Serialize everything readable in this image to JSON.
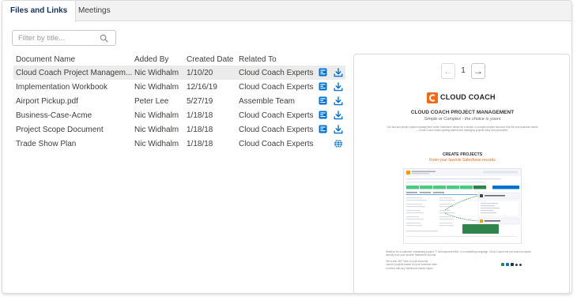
{
  "tabs": [
    {
      "label": "Files and Links",
      "active": true
    },
    {
      "label": "Meetings",
      "active": false
    }
  ],
  "filter": {
    "placeholder": "Filter by title...",
    "value": ""
  },
  "table": {
    "columns": [
      "Document Name",
      "Added By",
      "Created Date",
      "Related To"
    ],
    "rows": [
      {
        "name": "Cloud Coach Project Managem...",
        "added_by": "Nic Widhalm",
        "created": "1/10/20",
        "related": "Cloud Coach Experts",
        "icons": [
          "slides-icon",
          "download-icon"
        ],
        "selected": true
      },
      {
        "name": "Implementation Workbook",
        "added_by": "Nic Widhalm",
        "created": "12/16/19",
        "related": "Cloud Coach Experts",
        "icons": [
          "slides-icon",
          "download-icon"
        ],
        "selected": false
      },
      {
        "name": "Airport Pickup.pdf",
        "added_by": "Peter Lee",
        "created": "5/27/19",
        "related": "Assemble Team",
        "icons": [
          "slides-icon",
          "download-icon"
        ],
        "selected": false
      },
      {
        "name": "Business-Case-Acme",
        "added_by": "Nic Widhalm",
        "created": "1/18/18",
        "related": "Cloud Coach Experts",
        "icons": [
          "slides-icon",
          "download-icon"
        ],
        "selected": false
      },
      {
        "name": "Project Scope Document",
        "added_by": "Nic Widhalm",
        "created": "1/18/18",
        "related": "Cloud Coach Experts",
        "icons": [
          "slides-icon",
          "download-icon"
        ],
        "selected": false
      },
      {
        "name": "Trade Show Plan",
        "added_by": "Nic Widhalm",
        "created": "1/18/18",
        "related": "Cloud Coach Experts",
        "icons": [
          "",
          "globe-link-icon"
        ],
        "selected": false
      }
    ]
  },
  "preview": {
    "page": "1",
    "prev_symbol": "←",
    "next_symbol": "→",
    "document": {
      "logo_text": "CLOUD COACH",
      "title": "CLOUD COACH PROJECT MANAGEMENT",
      "subtitle": "Simple or Complex - the choice is yours",
      "paragraph": "Our fast and simple project management within Salesforce allows for a simple or complex project structure that fits your business needs—Cloud Coach makes getting started and managing projects easy and productive.",
      "section_heading": "CREATE PROJECTS",
      "section_subheading": "From your favorite Salesforce records",
      "footer_text": "Whether it's a customer onboarding project, IT development effort, or a marketing campaign, Cloud Coach lets you launch projects directly from your favorite Salesforce records.",
      "bullets": [
        "Get a true 360° view of your accounts",
        "Launch projects based on your business rules",
        "Connect with any Salesforce-based object"
      ],
      "shot_callout": "Automatically create projects when opportunities close"
    }
  },
  "colors": {
    "accent": "#0070d2",
    "brand_orange": "#f06a1c",
    "tab_bar": "#f3f2f2",
    "selected_row": "#ebebeb",
    "border": "#dddbda"
  }
}
